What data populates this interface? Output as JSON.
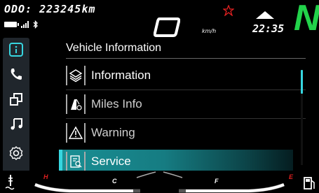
{
  "status": {
    "odometer_label": "ODO:",
    "odometer_value": "223245km",
    "speed_unit": "km/h",
    "clock": "22:35",
    "gear": "N",
    "bluetooth_glyph": "ʙ"
  },
  "rail": {
    "items": [
      {
        "icon": "info-icon"
      },
      {
        "icon": "phone-icon"
      },
      {
        "icon": "screen-mirror-icon"
      },
      {
        "icon": "music-icon"
      },
      {
        "icon": "settings-icon"
      }
    ]
  },
  "page": {
    "title": "Vehicle Information",
    "items": [
      {
        "label": "Information",
        "icon": "layers-icon"
      },
      {
        "label": "Miles Info",
        "icon": "road-icon"
      },
      {
        "label": "Warning",
        "icon": "warning-icon"
      },
      {
        "label": "Service",
        "icon": "service-icon",
        "selected": true
      }
    ]
  },
  "gauges": {
    "temp_high": "H",
    "temp_low": "C",
    "fuel_full": "F",
    "fuel_empty": "E"
  },
  "colors": {
    "accent": "#37d6e0",
    "gear": "#22d24a",
    "alert": "#e02020"
  }
}
